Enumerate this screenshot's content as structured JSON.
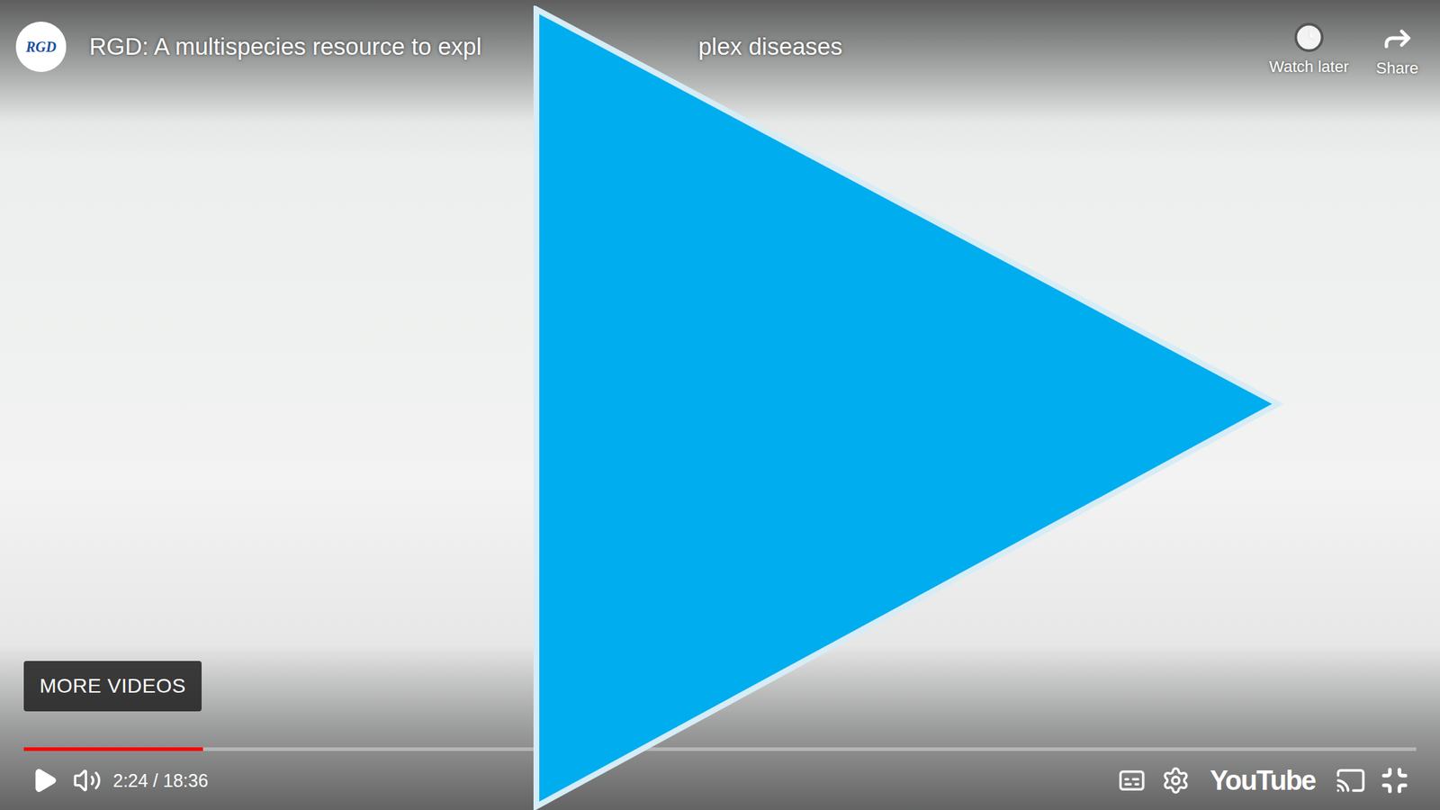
{
  "player": {
    "channel_avatar": "RGD",
    "title_parts": [
      "RGD: A multispecies resource to expl",
      "plex diseases"
    ],
    "actions": [
      {
        "label": "Watch later",
        "kind": "clock"
      },
      {
        "label": "Share",
        "kind": "share"
      }
    ],
    "more_videos": "MORE VIDEOS",
    "playing": false,
    "muted": false,
    "progress": {
      "level": 0.129
    },
    "time": "2:24 / 18:36",
    "brand": "YouTube",
    "captions_on": false
  }
}
